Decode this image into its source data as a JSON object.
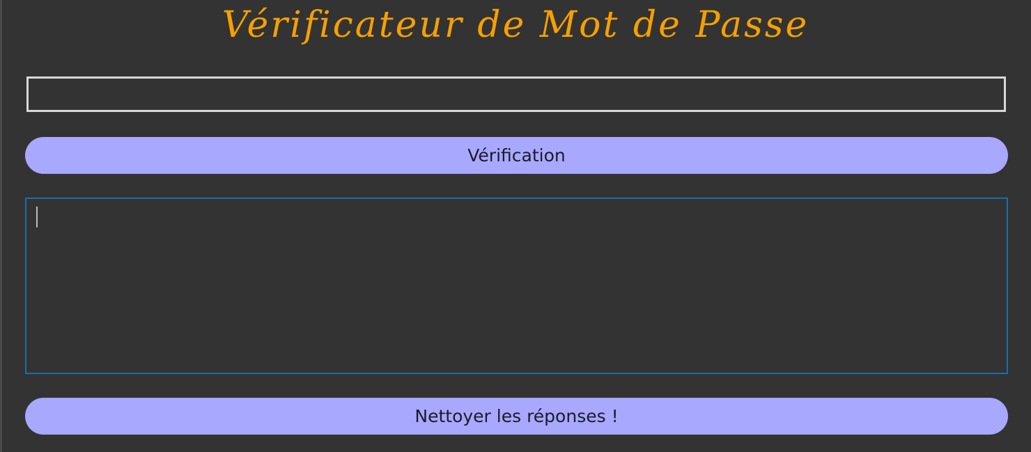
{
  "app": {
    "title": "Vérificateur de Mot de Passe"
  },
  "password_field": {
    "value": "",
    "placeholder": ""
  },
  "verify_button": {
    "label": "Vérification"
  },
  "responses_area": {
    "value": ""
  },
  "clear_button": {
    "label": "Nettoyer les réponses !"
  },
  "colors": {
    "background": "#333333",
    "title": "#f5a000",
    "button": "#a8a8ff",
    "input_border": "#d8d8d8",
    "textarea_border": "#1a6ea8"
  }
}
